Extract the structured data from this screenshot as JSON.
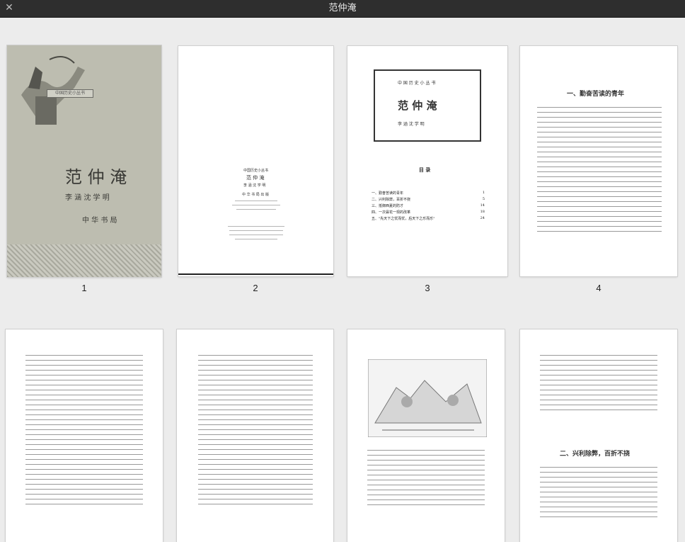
{
  "window": {
    "title": "范仲淹",
    "close_glyph": "✕"
  },
  "cover": {
    "series_tag": "中国历史小丛书",
    "title": "范 仲 淹",
    "authors": "李 涵   沈 学 明",
    "publisher": "中 华 书 局"
  },
  "page2": {
    "series": "中国历史小丛书",
    "title": "范 仲 淹",
    "authors": "李 涵  沈 学 明",
    "publisher": "中 华 书 局 出 版"
  },
  "page3": {
    "series": "中 国 历 史 小 丛 书",
    "title": "范 仲 淹",
    "authors": "李 涵   沈 学 明",
    "toc_heading": "目 录",
    "toc": [
      {
        "label": "一、勤奋苦读的青年",
        "page": "1"
      },
      {
        "label": "二、兴利除弊，百折不挠",
        "page": "5"
      },
      {
        "label": "三、抵御西夏的防才",
        "page": "14"
      },
      {
        "label": "四、一次昙花一现的改革",
        "page": "18"
      },
      {
        "label": "五、\"先天下之忧而忧，后天下之乐而乐\"",
        "page": "24"
      }
    ]
  },
  "page4": {
    "heading": "一、勤奋苦读的青年"
  },
  "page8": {
    "heading": "二、兴利除弊，百折不挠"
  },
  "thumbnails": [
    {
      "label": "1"
    },
    {
      "label": "2"
    },
    {
      "label": "3"
    },
    {
      "label": "4"
    }
  ]
}
